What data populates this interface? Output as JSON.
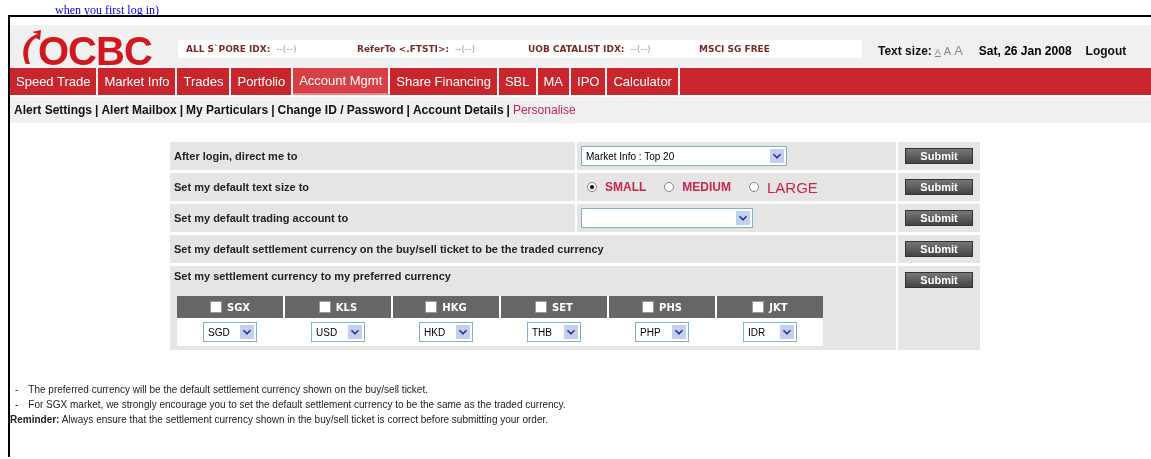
{
  "caption": "when you first log in)",
  "logo": {
    "text": "OCBC"
  },
  "ticker": [
    {
      "label": "ALL S`PORE IDX:",
      "value": "--(--)"
    },
    {
      "label": "ReferTo <.FTSTI>:",
      "value": "--(--)"
    },
    {
      "label": "UOB CATALIST IDX:",
      "value": "--(--)"
    },
    {
      "label": "MSCI SG FREE"
    }
  ],
  "text_size": {
    "label": "Text size:",
    "options": [
      {
        "label": "A",
        "selected": true
      },
      {
        "label": "A",
        "selected": false
      },
      {
        "label": "A",
        "selected": false
      }
    ]
  },
  "date": "Sat, 26 Jan 2008",
  "logout": "Logout",
  "nav": [
    {
      "label": "Speed Trade",
      "selected": false
    },
    {
      "label": "Market Info",
      "selected": false
    },
    {
      "label": "Trades",
      "selected": false
    },
    {
      "label": "Portfolio",
      "selected": false
    },
    {
      "label": "Account Mgmt",
      "selected": true
    },
    {
      "label": "Share Financing",
      "selected": false
    },
    {
      "label": "SBL",
      "selected": false
    },
    {
      "label": "MA",
      "selected": false
    },
    {
      "label": "IPO",
      "selected": false
    },
    {
      "label": "Calculator",
      "selected": false
    }
  ],
  "subnav": [
    {
      "kind": "link",
      "label": "Alert Settings",
      "selected": false
    },
    {
      "kind": "separator",
      "label": "|"
    },
    {
      "kind": "link",
      "label": "Alert Mailbox",
      "selected": false
    },
    {
      "kind": "separator",
      "label": "|"
    },
    {
      "kind": "link",
      "label": "My Particulars",
      "selected": false
    },
    {
      "kind": "separator",
      "label": "|"
    },
    {
      "kind": "link",
      "label": "Change ID / Password",
      "selected": false
    },
    {
      "kind": "separator",
      "label": "|"
    },
    {
      "kind": "link",
      "label": "Account Details",
      "selected": false
    },
    {
      "kind": "separator",
      "label": "|"
    },
    {
      "kind": "link",
      "label": "Personalise",
      "selected": true
    }
  ],
  "settings": [
    {
      "kind": "select",
      "label": "After login, direct me to",
      "value": "Market Info : Top 20",
      "button": "Submit"
    },
    {
      "kind": "radio",
      "label": "Set my default text size to",
      "options": [
        {
          "label": "SMALL",
          "selected": true
        },
        {
          "label": "MEDIUM",
          "selected": false
        },
        {
          "label": "LARGE",
          "selected": false
        }
      ],
      "button": "Submit"
    },
    {
      "kind": "select",
      "label": "Set my default trading account to",
      "button": "Submit"
    },
    {
      "kind": "plain",
      "label": "Set my default settlement currency on the buy/sell ticket to be the traded currency",
      "button": "Submit"
    },
    {
      "kind": "currency",
      "label": "Set my settlement currency to my preferred currency",
      "button": "Submit",
      "markets": [
        {
          "market": "SGX",
          "checked": false,
          "currency": "SGD"
        },
        {
          "market": "KLS",
          "checked": false,
          "currency": "USD"
        },
        {
          "market": "HKG",
          "checked": false,
          "currency": "HKD"
        },
        {
          "market": "SET",
          "checked": false,
          "currency": "THB"
        },
        {
          "market": "PHS",
          "checked": false,
          "currency": "PHP"
        },
        {
          "market": "JKT",
          "checked": false,
          "currency": "IDR"
        }
      ]
    }
  ],
  "notes": [
    {
      "bullet": "-",
      "text": "The preferred currency will be the default settlement currency shown on the buy/sell ticket."
    },
    {
      "bullet": "-",
      "text": "For SGX market, we strongly encourage you to set the default settlement currency to be the same as the traded currency."
    }
  ],
  "reminder": "**Reminder:** Always ensure that the settlement currency shown in the buy/sell ticket is correct before submitting your order."
}
